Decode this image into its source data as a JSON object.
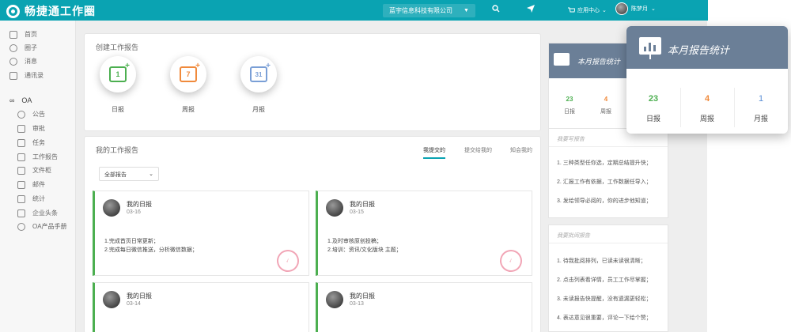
{
  "header": {
    "app_name": "畅捷通工作圈",
    "company": "蓝宇信息科技有限公司",
    "app_center": "应用中心",
    "user_name": "陈梦月",
    "icons": [
      "search-icon",
      "send-icon",
      "cart-icon",
      "chevron-down-icon"
    ]
  },
  "sidebar": {
    "items": [
      {
        "label": "首页",
        "icon": "home-icon"
      },
      {
        "label": "圈子",
        "icon": "circle-icon"
      },
      {
        "label": "消息",
        "icon": "message-icon"
      },
      {
        "label": "通讯录",
        "icon": "contacts-icon"
      }
    ],
    "oa_label": "OA",
    "oa_items": [
      {
        "label": "公告",
        "icon": "bell-icon"
      },
      {
        "label": "审批",
        "icon": "approval-icon"
      },
      {
        "label": "任务",
        "icon": "task-icon"
      },
      {
        "label": "工作报告",
        "icon": "report-icon"
      },
      {
        "label": "文件柜",
        "icon": "folder-icon"
      },
      {
        "label": "邮件",
        "icon": "mail-icon"
      },
      {
        "label": "统计",
        "icon": "stats-icon"
      },
      {
        "label": "企业头条",
        "icon": "news-icon"
      },
      {
        "label": "OA产品手册",
        "icon": "help-icon"
      }
    ]
  },
  "create_panel": {
    "title": "创建工作报告",
    "types": [
      {
        "label": "日报",
        "number": "1",
        "color": "#4caf50"
      },
      {
        "label": "周报",
        "number": "7",
        "color": "#f08a3c"
      },
      {
        "label": "月报",
        "number": "31",
        "color": "#7a9fd6"
      }
    ]
  },
  "my_reports": {
    "title": "我的工作报告",
    "tabs": [
      "我提交的",
      "提交给我的",
      "知会我的"
    ],
    "filter": "全部报告",
    "cards": [
      {
        "title": "我的日报",
        "date": "03-16",
        "lines": [
          "1.完成首页日常更新；",
          "2.完成每日微信推送，分析微信数据；"
        ],
        "stamp": true
      },
      {
        "title": "我的日报",
        "date": "03-15",
        "lines": [
          "1.及时审核原创投稿；",
          "2.培训：资讯/文化版块 主题；"
        ],
        "stamp": true
      },
      {
        "title": "我的日报",
        "date": "03-14",
        "lines": [],
        "stamp": false
      },
      {
        "title": "我的日报",
        "date": "03-13",
        "lines": [],
        "stamp": false
      }
    ]
  },
  "monthly_stats": {
    "title": "本月报告统计",
    "items": [
      {
        "label": "日报",
        "value": "23",
        "color": "#4caf50"
      },
      {
        "label": "周报",
        "value": "4",
        "color": "#f08a3c"
      },
      {
        "label": "月报",
        "value": "1",
        "color": "#5b8fd6"
      }
    ]
  },
  "write_reports": {
    "title": "我要写报告",
    "items": [
      "1. 三种类型任你选，定期总结提升快；",
      "2. 汇报工作有依据，工作数据任导入；",
      "3. 发给领导必阅的，你的进步他知道；"
    ]
  },
  "read_reports": {
    "title": "我要批阅报告",
    "items": [
      "1. 待我批阅排列，已读未读很清晰；",
      "2. 点击列表看详情，员工工作尽掌握；",
      "3. 未读报告快提醒，没有遗漏更轻松；",
      "4. 表达意见很重要，评论一下给个赞；"
    ]
  }
}
